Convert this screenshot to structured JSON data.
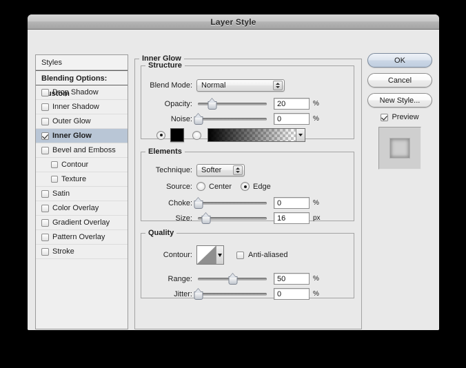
{
  "window": {
    "title": "Layer Style"
  },
  "sidebar": {
    "styles_label": "Styles",
    "blending_label": "Blending Options: Custom",
    "items": [
      {
        "label": "Drop Shadow",
        "checked": false,
        "indent": false,
        "selected": false
      },
      {
        "label": "Inner Shadow",
        "checked": false,
        "indent": false,
        "selected": false
      },
      {
        "label": "Outer Glow",
        "checked": false,
        "indent": false,
        "selected": false
      },
      {
        "label": "Inner Glow",
        "checked": true,
        "indent": false,
        "selected": true
      },
      {
        "label": "Bevel and Emboss",
        "checked": false,
        "indent": false,
        "selected": false
      },
      {
        "label": "Contour",
        "checked": false,
        "indent": true,
        "selected": false
      },
      {
        "label": "Texture",
        "checked": false,
        "indent": true,
        "selected": false
      },
      {
        "label": "Satin",
        "checked": false,
        "indent": false,
        "selected": false
      },
      {
        "label": "Color Overlay",
        "checked": false,
        "indent": false,
        "selected": false
      },
      {
        "label": "Gradient Overlay",
        "checked": false,
        "indent": false,
        "selected": false
      },
      {
        "label": "Pattern Overlay",
        "checked": false,
        "indent": false,
        "selected": false
      },
      {
        "label": "Stroke",
        "checked": false,
        "indent": false,
        "selected": false
      }
    ]
  },
  "main": {
    "group_title": "Inner Glow",
    "structure": {
      "title": "Structure",
      "blend_mode_label": "Blend Mode:",
      "blend_mode_value": "Normal",
      "opacity_label": "Opacity:",
      "opacity_value": "20",
      "opacity_unit": "%",
      "noise_label": "Noise:",
      "noise_value": "0",
      "noise_unit": "%",
      "fill_type": "gradient-row",
      "color_radio_selected": true,
      "gradient_radio_selected": false,
      "color_swatch_hex": "#000000"
    },
    "elements": {
      "title": "Elements",
      "technique_label": "Technique:",
      "technique_value": "Softer",
      "source_label": "Source:",
      "source_center_label": "Center",
      "source_edge_label": "Edge",
      "source_selected": "Edge",
      "choke_label": "Choke:",
      "choke_value": "0",
      "choke_unit": "%",
      "size_label": "Size:",
      "size_value": "16",
      "size_unit": "px"
    },
    "quality": {
      "title": "Quality",
      "contour_label": "Contour:",
      "anti_aliased_label": "Anti-aliased",
      "anti_aliased_checked": false,
      "range_label": "Range:",
      "range_value": "50",
      "range_unit": "%",
      "jitter_label": "Jitter:",
      "jitter_value": "0",
      "jitter_unit": "%"
    }
  },
  "right": {
    "ok_label": "OK",
    "cancel_label": "Cancel",
    "new_style_label": "New Style...",
    "preview_label": "Preview",
    "preview_checked": true
  },
  "sliders": {
    "opacity_pct": 20,
    "noise_pct": 0,
    "choke_pct": 0,
    "size_pct": 11,
    "range_pct": 50,
    "jitter_pct": 0
  }
}
